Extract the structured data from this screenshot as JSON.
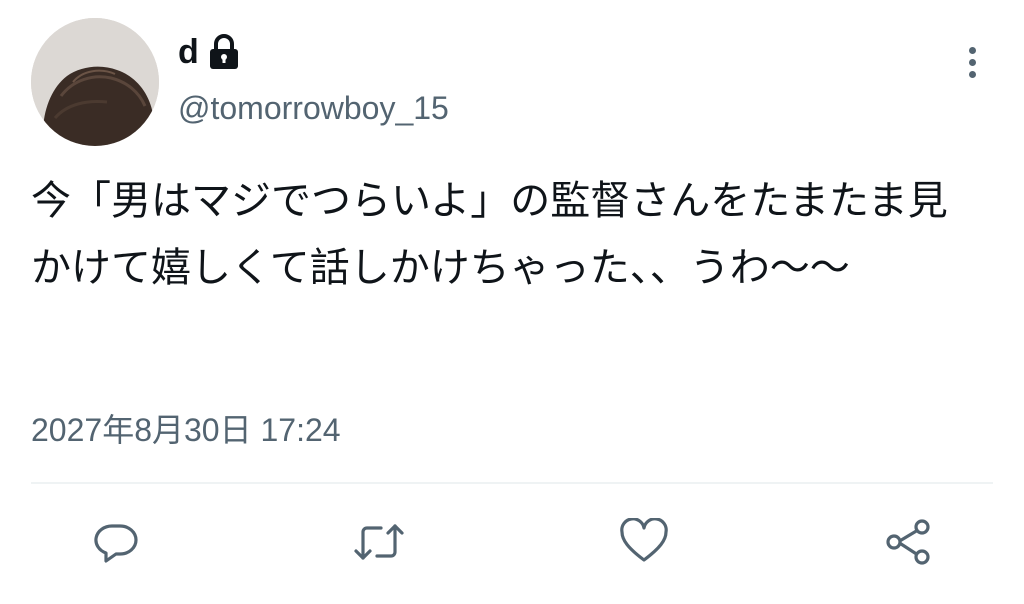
{
  "tweet": {
    "display_name": "d",
    "handle": "@tomorrowboy_15",
    "text": "今「男はマジでつらいよ」の監督さんをたまたま見かけて嬉しくて話しかけちゃった、、うわ〜〜",
    "timestamp": "2027年8月30日 17:24",
    "protected": true
  },
  "icons": {
    "lock": "lock-icon",
    "more": "more-icon",
    "reply": "reply-icon",
    "retweet": "retweet-icon",
    "like": "heart-icon",
    "share": "share-icon"
  },
  "colors": {
    "text_primary": "#0f1419",
    "text_secondary": "#536471",
    "divider": "#eff3f4",
    "background": "#ffffff"
  }
}
